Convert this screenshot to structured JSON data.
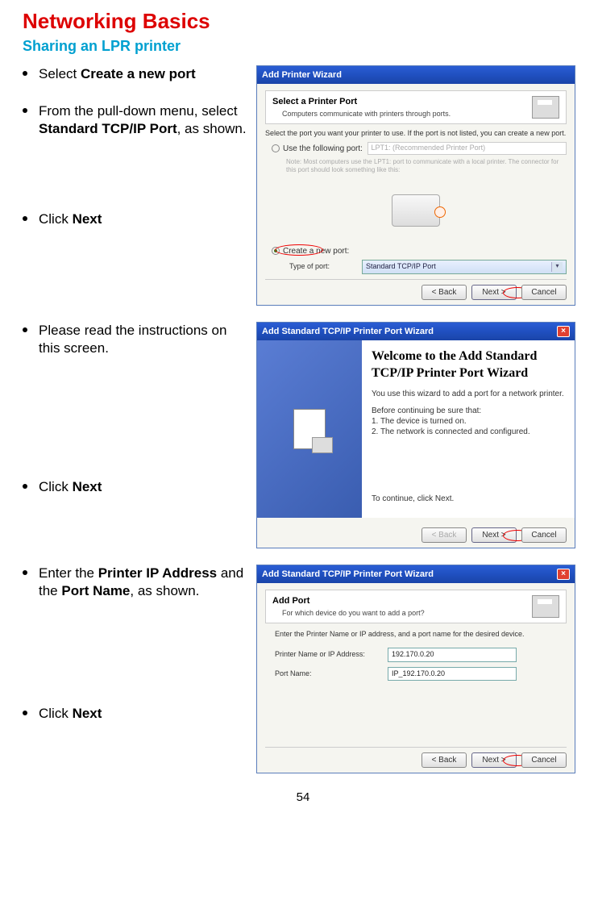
{
  "heading": "Networking Basics",
  "subheading": "Sharing an LPR printer",
  "section1": {
    "bullets": [
      {
        "pre": "Select ",
        "bold": "Create a new port",
        "post": ""
      },
      {
        "pre": "From the pull-down menu, select ",
        "bold": "Standard TCP/IP Port",
        "post": ", as shown."
      },
      {
        "pre": "Click ",
        "bold": "Next",
        "post": ""
      }
    ],
    "dialog": {
      "title": "Add Printer Wizard",
      "header_title": "Select a Printer Port",
      "header_sub": "Computers communicate with printers through ports.",
      "desc": "Select the port you want your printer to use.  If the port is not listed, you can create a new port.",
      "opt1_label": "Use the following port:",
      "opt1_value": "LPT1: (Recommended Printer Port)",
      "opt1_note": "Note: Most computers use the LPT1: port to communicate with a local printer. The connector for this port should look something like this:",
      "opt2_label1": "Create a new port:",
      "opt2_label2": "Type of port:",
      "opt2_value": "Standard TCP/IP Port",
      "btn_back": "< Back",
      "btn_next": "Next >",
      "btn_cancel": "Cancel"
    }
  },
  "section2": {
    "bullets": [
      {
        "pre": "Please read the instructions on this screen.",
        "bold": "",
        "post": ""
      },
      {
        "pre": "Click ",
        "bold": "Next",
        "post": ""
      }
    ],
    "dialog": {
      "title": "Add Standard TCP/IP Printer Port Wizard",
      "big": "Welcome to the Add Standard TCP/IP Printer Port Wizard",
      "line1": "You use this wizard to add a port for a network printer.",
      "line2": "Before continuing be sure that:",
      "line3": "1.  The device is turned on.",
      "line4": "2.  The network is connected and configured.",
      "cont": "To continue, click Next.",
      "btn_back": "< Back",
      "btn_next": "Next >",
      "btn_cancel": "Cancel"
    }
  },
  "section3": {
    "bullets": [
      {
        "pre": "Enter the ",
        "bold": "Printer IP Address",
        "post_pre": " and the ",
        "bold2": "Port Name",
        "post": ", as shown."
      },
      {
        "pre": "Click ",
        "bold": "Next",
        "post": ""
      }
    ],
    "dialog": {
      "title": "Add Standard TCP/IP Printer Port Wizard",
      "header_title": "Add Port",
      "header_sub": "For which device do you want to add a port?",
      "desc": "Enter the Printer Name or IP address, and a port name for the desired device.",
      "field1_label": "Printer Name or IP Address:",
      "field1_value": "192.170.0.20",
      "field2_label": "Port Name:",
      "field2_value": "IP_192.170.0.20",
      "btn_back": "< Back",
      "btn_next": "Next >",
      "btn_cancel": "Cancel"
    }
  },
  "page_number": "54"
}
